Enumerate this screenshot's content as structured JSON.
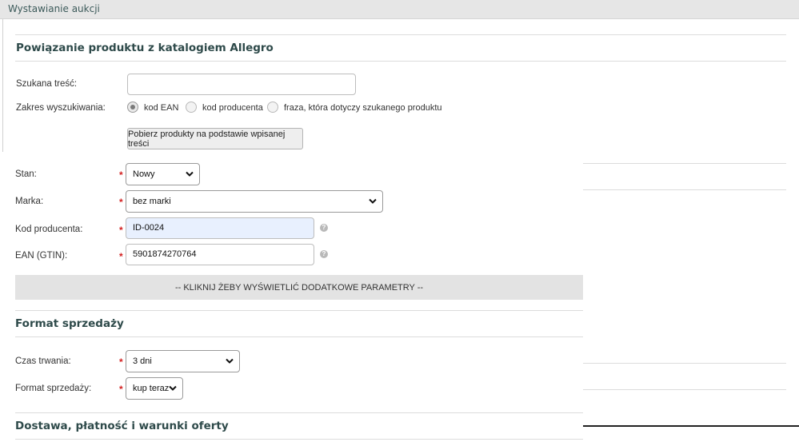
{
  "window": {
    "title": "Wystawianie aukcji"
  },
  "catalog_section": {
    "title": "Powiązanie produktu z katalogiem Allegro",
    "search_label": "Szukana treść:",
    "search_value": "",
    "scope_label": "Zakres wyszukiwania:",
    "scope_options": [
      "kod EAN",
      "kod producenta",
      "fraza, która dotyczy szukanego produktu"
    ],
    "scope_selected": "kod EAN",
    "fetch_button": "Pobierz produkty na podstawie wpisanej treści"
  },
  "product_fields": {
    "condition": {
      "label": "Stan:",
      "value": "Nowy",
      "required": "*"
    },
    "brand": {
      "label": "Marka:",
      "value": "bez marki",
      "required": "*"
    },
    "producer_code": {
      "label": "Kod producenta:",
      "value": "ID-0024",
      "required": "*"
    },
    "ean": {
      "label": "EAN (GTIN):",
      "value": "5901874270764",
      "required": "*"
    },
    "help_icon": "?"
  },
  "extra_params_bar": "-- KLIKNIJ ŻEBY WYŚWIETLIĆ DODATKOWE PARAMETRY --",
  "sale_format_section": {
    "title": "Format sprzedaży",
    "duration": {
      "label": "Czas trwania:",
      "value": "3 dni",
      "required": "*"
    },
    "format": {
      "label": "Format sprzedaży:",
      "value": "kup teraz",
      "required": "*"
    }
  },
  "delivery_section": {
    "title": "Dostawa, płatność i warunki oferty"
  },
  "colors": {
    "required": "#d31f1f",
    "title": "#2e4a4a",
    "autofill": "#e8f0fe"
  }
}
